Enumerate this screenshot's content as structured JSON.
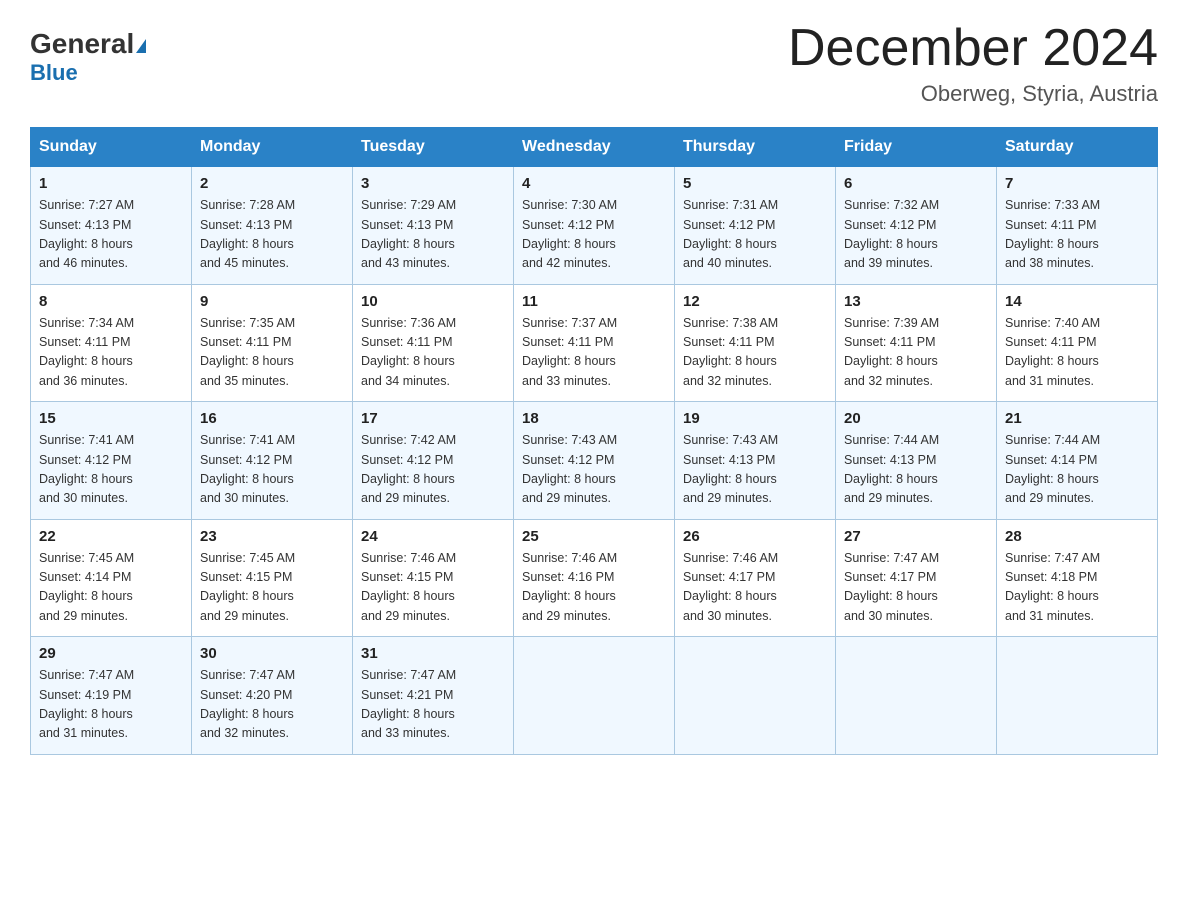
{
  "header": {
    "logo_general": "General",
    "logo_blue": "Blue",
    "title": "December 2024",
    "location": "Oberweg, Styria, Austria"
  },
  "days_of_week": [
    "Sunday",
    "Monday",
    "Tuesday",
    "Wednesday",
    "Thursday",
    "Friday",
    "Saturday"
  ],
  "weeks": [
    [
      {
        "day": "1",
        "sunrise": "7:27 AM",
        "sunset": "4:13 PM",
        "daylight": "8 hours and 46 minutes."
      },
      {
        "day": "2",
        "sunrise": "7:28 AM",
        "sunset": "4:13 PM",
        "daylight": "8 hours and 45 minutes."
      },
      {
        "day": "3",
        "sunrise": "7:29 AM",
        "sunset": "4:13 PM",
        "daylight": "8 hours and 43 minutes."
      },
      {
        "day": "4",
        "sunrise": "7:30 AM",
        "sunset": "4:12 PM",
        "daylight": "8 hours and 42 minutes."
      },
      {
        "day": "5",
        "sunrise": "7:31 AM",
        "sunset": "4:12 PM",
        "daylight": "8 hours and 40 minutes."
      },
      {
        "day": "6",
        "sunrise": "7:32 AM",
        "sunset": "4:12 PM",
        "daylight": "8 hours and 39 minutes."
      },
      {
        "day": "7",
        "sunrise": "7:33 AM",
        "sunset": "4:11 PM",
        "daylight": "8 hours and 38 minutes."
      }
    ],
    [
      {
        "day": "8",
        "sunrise": "7:34 AM",
        "sunset": "4:11 PM",
        "daylight": "8 hours and 36 minutes."
      },
      {
        "day": "9",
        "sunrise": "7:35 AM",
        "sunset": "4:11 PM",
        "daylight": "8 hours and 35 minutes."
      },
      {
        "day": "10",
        "sunrise": "7:36 AM",
        "sunset": "4:11 PM",
        "daylight": "8 hours and 34 minutes."
      },
      {
        "day": "11",
        "sunrise": "7:37 AM",
        "sunset": "4:11 PM",
        "daylight": "8 hours and 33 minutes."
      },
      {
        "day": "12",
        "sunrise": "7:38 AM",
        "sunset": "4:11 PM",
        "daylight": "8 hours and 32 minutes."
      },
      {
        "day": "13",
        "sunrise": "7:39 AM",
        "sunset": "4:11 PM",
        "daylight": "8 hours and 32 minutes."
      },
      {
        "day": "14",
        "sunrise": "7:40 AM",
        "sunset": "4:11 PM",
        "daylight": "8 hours and 31 minutes."
      }
    ],
    [
      {
        "day": "15",
        "sunrise": "7:41 AM",
        "sunset": "4:12 PM",
        "daylight": "8 hours and 30 minutes."
      },
      {
        "day": "16",
        "sunrise": "7:41 AM",
        "sunset": "4:12 PM",
        "daylight": "8 hours and 30 minutes."
      },
      {
        "day": "17",
        "sunrise": "7:42 AM",
        "sunset": "4:12 PM",
        "daylight": "8 hours and 29 minutes."
      },
      {
        "day": "18",
        "sunrise": "7:43 AM",
        "sunset": "4:12 PM",
        "daylight": "8 hours and 29 minutes."
      },
      {
        "day": "19",
        "sunrise": "7:43 AM",
        "sunset": "4:13 PM",
        "daylight": "8 hours and 29 minutes."
      },
      {
        "day": "20",
        "sunrise": "7:44 AM",
        "sunset": "4:13 PM",
        "daylight": "8 hours and 29 minutes."
      },
      {
        "day": "21",
        "sunrise": "7:44 AM",
        "sunset": "4:14 PM",
        "daylight": "8 hours and 29 minutes."
      }
    ],
    [
      {
        "day": "22",
        "sunrise": "7:45 AM",
        "sunset": "4:14 PM",
        "daylight": "8 hours and 29 minutes."
      },
      {
        "day": "23",
        "sunrise": "7:45 AM",
        "sunset": "4:15 PM",
        "daylight": "8 hours and 29 minutes."
      },
      {
        "day": "24",
        "sunrise": "7:46 AM",
        "sunset": "4:15 PM",
        "daylight": "8 hours and 29 minutes."
      },
      {
        "day": "25",
        "sunrise": "7:46 AM",
        "sunset": "4:16 PM",
        "daylight": "8 hours and 29 minutes."
      },
      {
        "day": "26",
        "sunrise": "7:46 AM",
        "sunset": "4:17 PM",
        "daylight": "8 hours and 30 minutes."
      },
      {
        "day": "27",
        "sunrise": "7:47 AM",
        "sunset": "4:17 PM",
        "daylight": "8 hours and 30 minutes."
      },
      {
        "day": "28",
        "sunrise": "7:47 AM",
        "sunset": "4:18 PM",
        "daylight": "8 hours and 31 minutes."
      }
    ],
    [
      {
        "day": "29",
        "sunrise": "7:47 AM",
        "sunset": "4:19 PM",
        "daylight": "8 hours and 31 minutes."
      },
      {
        "day": "30",
        "sunrise": "7:47 AM",
        "sunset": "4:20 PM",
        "daylight": "8 hours and 32 minutes."
      },
      {
        "day": "31",
        "sunrise": "7:47 AM",
        "sunset": "4:21 PM",
        "daylight": "8 hours and 33 minutes."
      },
      null,
      null,
      null,
      null
    ]
  ],
  "labels": {
    "sunrise": "Sunrise:",
    "sunset": "Sunset:",
    "daylight": "Daylight:"
  },
  "colors": {
    "header_bg": "#2a82c7",
    "odd_row_bg": "#f0f8ff",
    "even_row_bg": "#ffffff",
    "border": "#aac8e0"
  }
}
